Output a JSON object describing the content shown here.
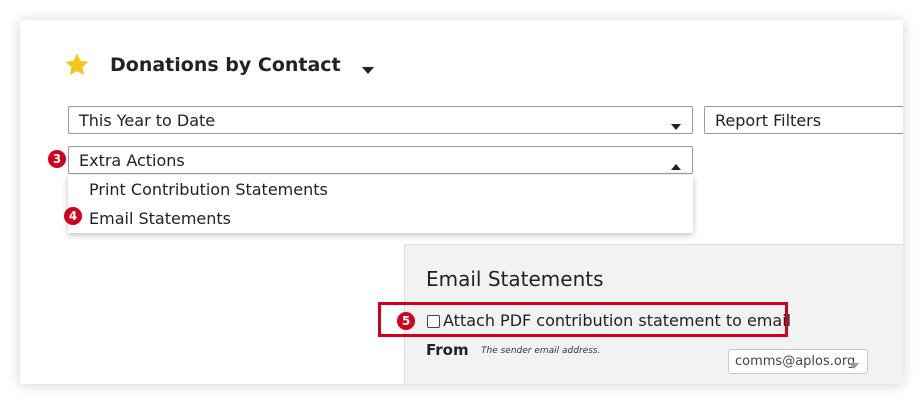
{
  "header": {
    "title": "Donations by Contact",
    "star_color": "#f5c518"
  },
  "selects": {
    "date_range": "This Year to Date",
    "report_filters": "Report Filters",
    "extra_actions": "Extra Actions"
  },
  "dropdown": {
    "items": [
      "Print Contribution Statements",
      "Email Statements"
    ]
  },
  "badges": {
    "step3": "3",
    "step4": "4",
    "step5": "5",
    "color": "#d0021b"
  },
  "email_panel": {
    "title": "Email Statements",
    "attach_label": "Attach PDF contribution statement to email",
    "attach_checked": false,
    "from_label": "From",
    "from_help": "The sender email address.",
    "from_value": "comms@aplos.org"
  }
}
